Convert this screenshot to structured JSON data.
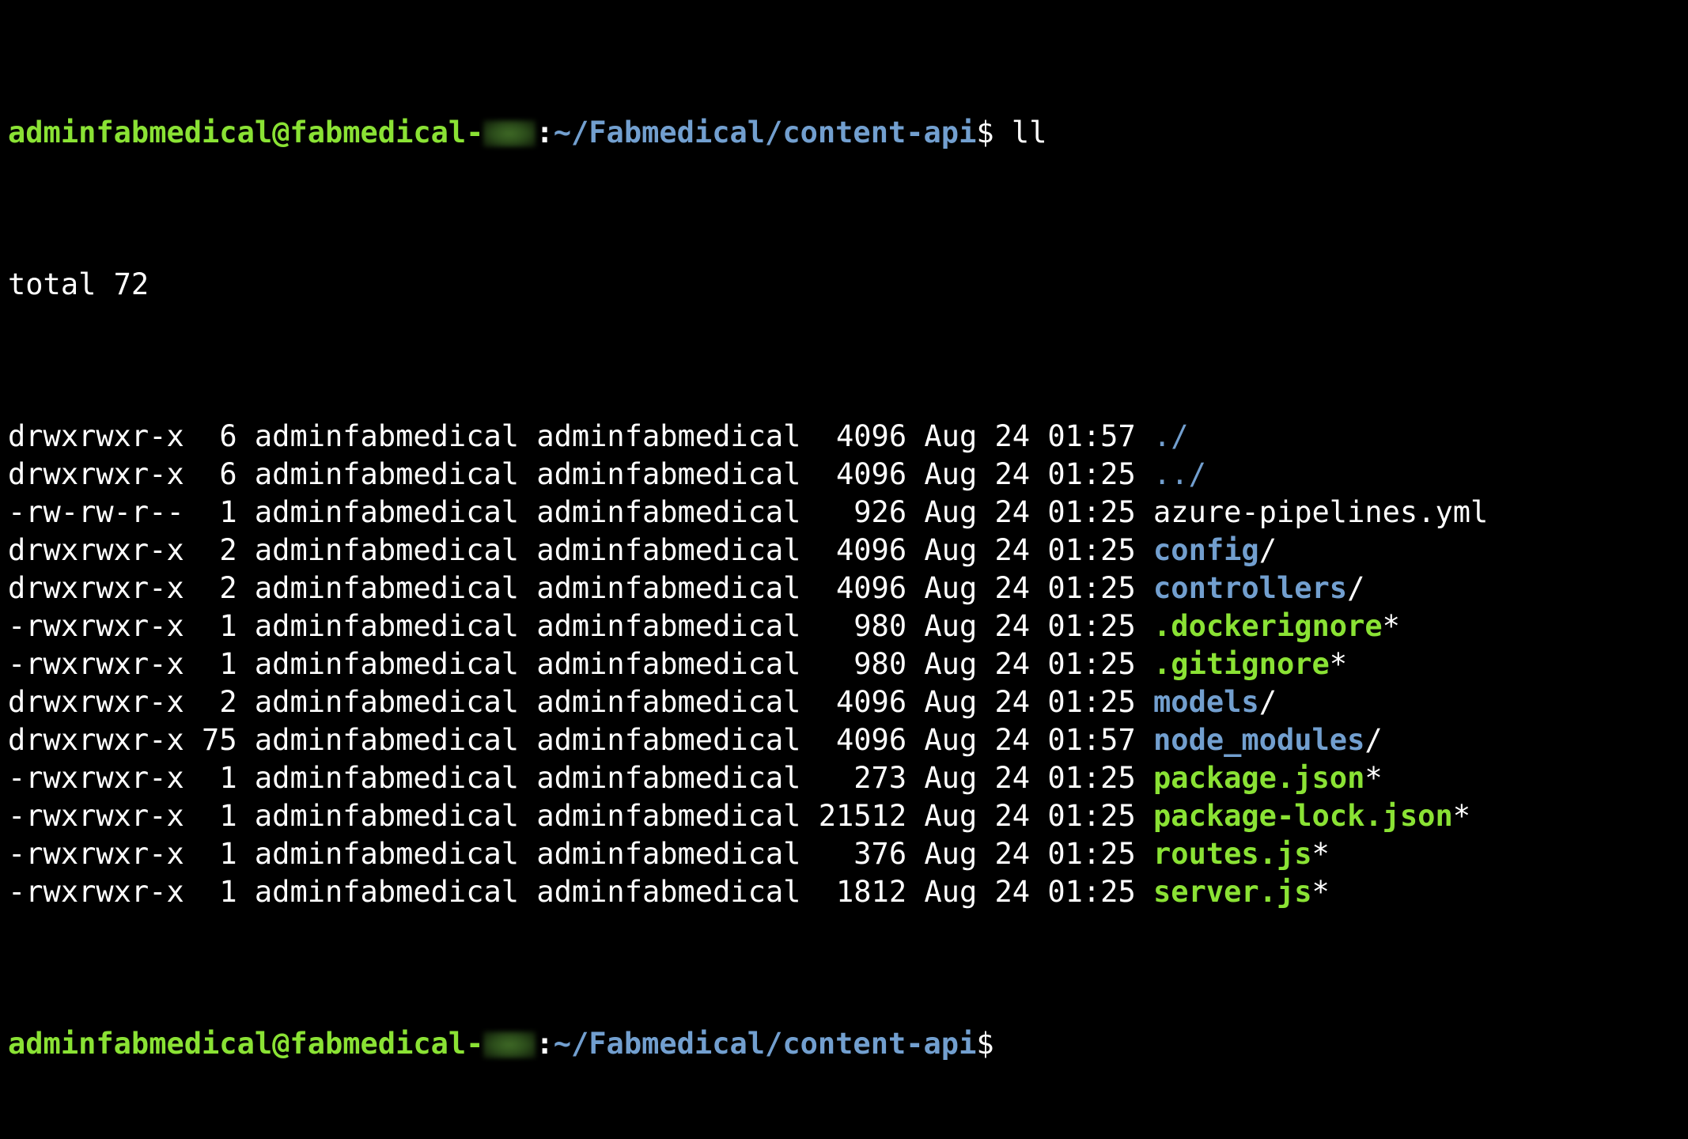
{
  "prompt": {
    "user_host": "adminfabmedical@fabmedical-",
    "separator": ":",
    "path": "~/Fabmedical/content-api",
    "dollar": "$"
  },
  "command": " ll",
  "total_line": "total 72",
  "colors": {
    "background": "#000000",
    "prompt_green": "#8ae234",
    "directory_blue": "#729fcf",
    "text_white": "#ffffff"
  },
  "listing": [
    {
      "perms": "drwxrwxr-x",
      "links": " 6",
      "owner": "adminfabmedical",
      "group": "adminfabmedical",
      "size": " 4096",
      "month": "Aug",
      "day": "24",
      "time": "01:57",
      "name": "./",
      "suffix": "",
      "kind": "dot"
    },
    {
      "perms": "drwxrwxr-x",
      "links": " 6",
      "owner": "adminfabmedical",
      "group": "adminfabmedical",
      "size": " 4096",
      "month": "Aug",
      "day": "24",
      "time": "01:25",
      "name": "../",
      "suffix": "",
      "kind": "dot"
    },
    {
      "perms": "-rw-rw-r--",
      "links": " 1",
      "owner": "adminfabmedical",
      "group": "adminfabmedical",
      "size": "  926",
      "month": "Aug",
      "day": "24",
      "time": "01:25",
      "name": "azure-pipelines.yml",
      "suffix": "",
      "kind": "file"
    },
    {
      "perms": "drwxrwxr-x",
      "links": " 2",
      "owner": "adminfabmedical",
      "group": "adminfabmedical",
      "size": " 4096",
      "month": "Aug",
      "day": "24",
      "time": "01:25",
      "name": "config",
      "suffix": "/",
      "kind": "dir"
    },
    {
      "perms": "drwxrwxr-x",
      "links": " 2",
      "owner": "adminfabmedical",
      "group": "adminfabmedical",
      "size": " 4096",
      "month": "Aug",
      "day": "24",
      "time": "01:25",
      "name": "controllers",
      "suffix": "/",
      "kind": "dir"
    },
    {
      "perms": "-rwxrwxr-x",
      "links": " 1",
      "owner": "adminfabmedical",
      "group": "adminfabmedical",
      "size": "  980",
      "month": "Aug",
      "day": "24",
      "time": "01:25",
      "name": ".dockerignore",
      "suffix": "*",
      "kind": "exec"
    },
    {
      "perms": "-rwxrwxr-x",
      "links": " 1",
      "owner": "adminfabmedical",
      "group": "adminfabmedical",
      "size": "  980",
      "month": "Aug",
      "day": "24",
      "time": "01:25",
      "name": ".gitignore",
      "suffix": "*",
      "kind": "exec"
    },
    {
      "perms": "drwxrwxr-x",
      "links": " 2",
      "owner": "adminfabmedical",
      "group": "adminfabmedical",
      "size": " 4096",
      "month": "Aug",
      "day": "24",
      "time": "01:25",
      "name": "models",
      "suffix": "/",
      "kind": "dir"
    },
    {
      "perms": "drwxrwxr-x",
      "links": "75",
      "owner": "adminfabmedical",
      "group": "adminfabmedical",
      "size": " 4096",
      "month": "Aug",
      "day": "24",
      "time": "01:57",
      "name": "node_modules",
      "suffix": "/",
      "kind": "dir"
    },
    {
      "perms": "-rwxrwxr-x",
      "links": " 1",
      "owner": "adminfabmedical",
      "group": "adminfabmedical",
      "size": "  273",
      "month": "Aug",
      "day": "24",
      "time": "01:25",
      "name": "package.json",
      "suffix": "*",
      "kind": "exec"
    },
    {
      "perms": "-rwxrwxr-x",
      "links": " 1",
      "owner": "adminfabmedical",
      "group": "adminfabmedical",
      "size": "21512",
      "month": "Aug",
      "day": "24",
      "time": "01:25",
      "name": "package-lock.json",
      "suffix": "*",
      "kind": "exec"
    },
    {
      "perms": "-rwxrwxr-x",
      "links": " 1",
      "owner": "adminfabmedical",
      "group": "adminfabmedical",
      "size": "  376",
      "month": "Aug",
      "day": "24",
      "time": "01:25",
      "name": "routes.js",
      "suffix": "*",
      "kind": "exec"
    },
    {
      "perms": "-rwxrwxr-x",
      "links": " 1",
      "owner": "adminfabmedical",
      "group": "adminfabmedical",
      "size": " 1812",
      "month": "Aug",
      "day": "24",
      "time": "01:25",
      "name": "server.js",
      "suffix": "*",
      "kind": "exec"
    }
  ]
}
